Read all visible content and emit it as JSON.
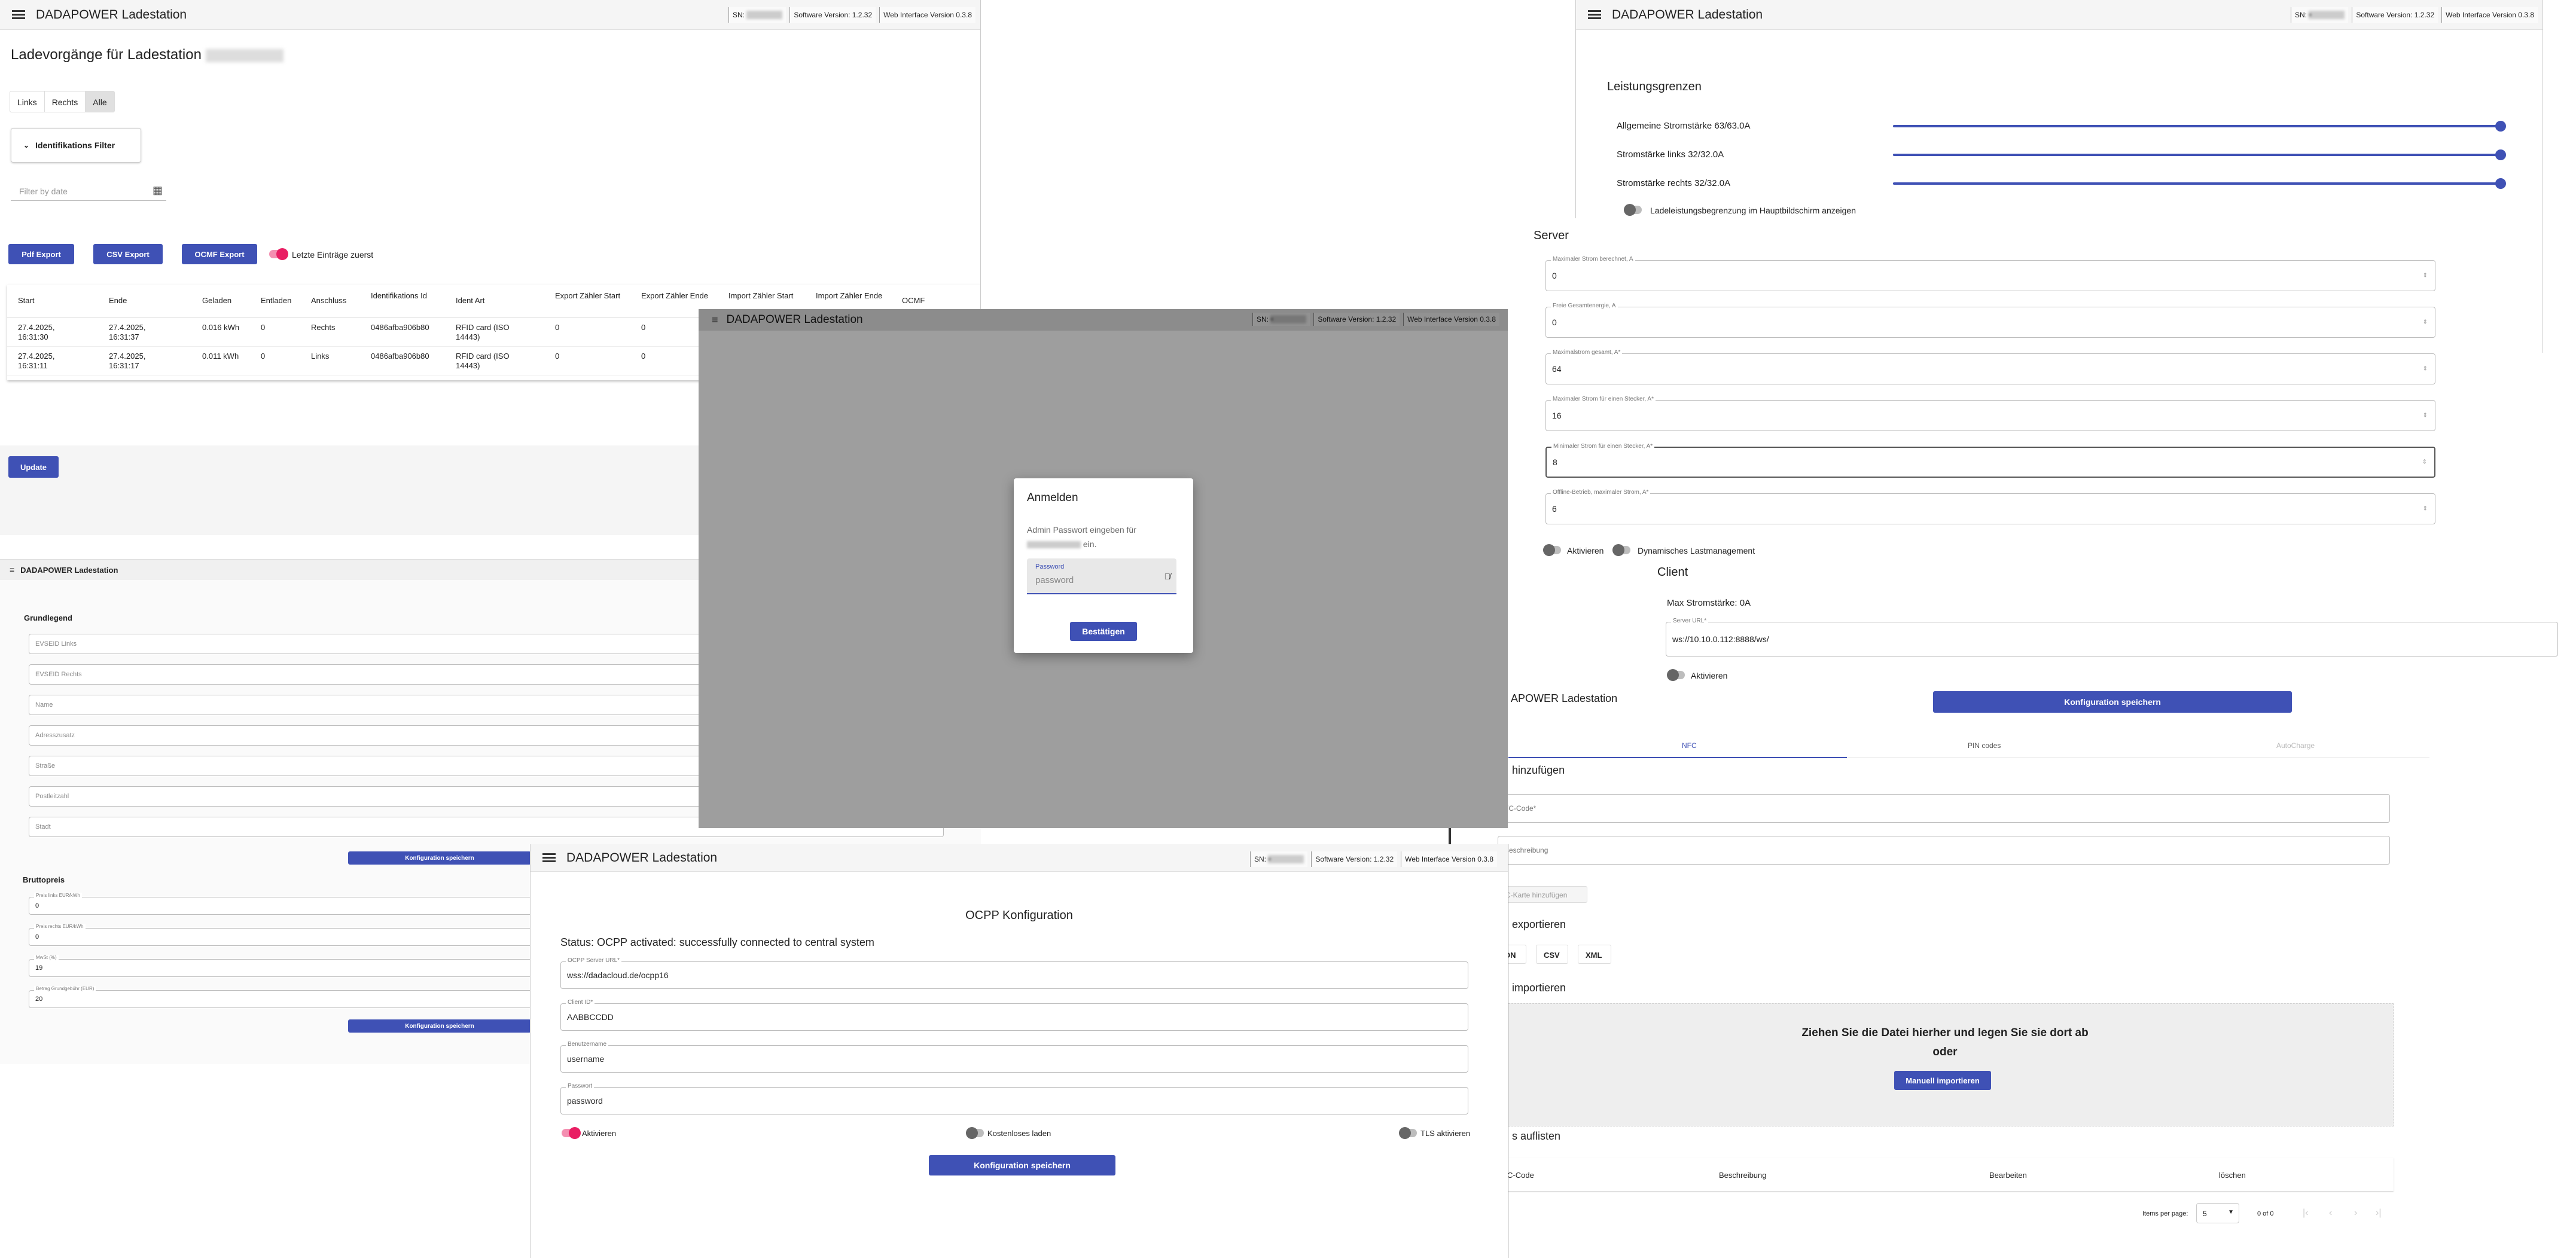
{
  "app": {
    "title": "DADAPOWER Ladestation",
    "sn": "SN:",
    "sw_version": "Software Version: 1.2.32",
    "web_version": "Web Interface Version 0.3.8"
  },
  "history": {
    "heading": "Ladevorgänge für Ladestation",
    "tabs": [
      "Links",
      "Rechts",
      "Alle"
    ],
    "filter_label": "Identifikations Filter",
    "date_placeholder": "Filter by date",
    "buttons": [
      "Pdf Export",
      "CSV Export",
      "OCMF Export"
    ],
    "newest_first_label": "Letzte Einträge zuerst",
    "columns": [
      "Start",
      "Ende",
      "Geladen",
      "Entladen",
      "Anschluss",
      "Identifikations Id",
      "Ident Art",
      "Export Zähler Start",
      "Export Zähler Ende",
      "Import Zähler Start",
      "Import Zähler Ende",
      "OCMF"
    ],
    "rows": [
      [
        "27.4.2025, 16:31:30",
        "27.4.2025, 16:31:37",
        "0.016 kWh",
        "0",
        "Rechts",
        "0486afba906b80",
        "RFID card (ISO 14443)",
        "0",
        "0",
        "",
        "",
        ""
      ],
      [
        "27.4.2025, 16:31:11",
        "27.4.2025, 16:31:17",
        "0.011 kWh",
        "0",
        "Links",
        "0486afba906b80",
        "RFID card (ISO 14443)",
        "0",
        "0",
        "",
        "",
        ""
      ]
    ],
    "update_label": "Update"
  },
  "basic": {
    "title": "DADAPOWER Ladestation",
    "section": "Grundlegend",
    "fields": [
      "EVSEID Links",
      "EVSEID Rechts",
      "Name",
      "Adresszusatz",
      "Straße",
      "Postleitzahl",
      "Stadt"
    ],
    "save_label": "Konfiguration speichern",
    "price_section": "Bruttopreis",
    "price_fields": [
      {
        "label": "Preis links EUR/kWh",
        "value": "0"
      },
      {
        "label": "Preis rechts EUR/kWh",
        "value": "0"
      },
      {
        "label": "MwSt (%)",
        "value": "19"
      },
      {
        "label": "Betrag Grundgebühr (EUR)",
        "value": "20"
      }
    ]
  },
  "power": {
    "section": "Leistungsgrenzen",
    "sliders": [
      {
        "label": "Allgemeine Stromstärke 63/63.0A",
        "fraction": 1.0
      },
      {
        "label": "Stromstärke links 32/32.0A",
        "fraction": 1.0
      },
      {
        "label": "Stromstärke rechts 32/32.0A",
        "fraction": 1.0
      }
    ],
    "show_limit_label": "Ladeleistungsbegrenzung im Hauptbildschirm anzeigen"
  },
  "server": {
    "section": "Server",
    "fields": [
      {
        "label": "Maximaler Strom berechnet, A",
        "value": "0"
      },
      {
        "label": "Freie Gesamtenergie, A",
        "value": "0"
      },
      {
        "label": "Maximalstrom gesamt, A*",
        "value": "64"
      },
      {
        "label": "Maximaler Strom für einen Stecker, A*",
        "value": "16"
      },
      {
        "label": "Minimaler Strom für einen Stecker, A*",
        "value": "8"
      },
      {
        "label": "Offline-Betrieb, maximaler Strom, A*",
        "value": "6"
      }
    ],
    "activate_label": "Aktivieren",
    "dynamic_label": "Dynamisches Lastmanagement"
  },
  "client": {
    "section": "Client",
    "max_current": "Max Stromstärke: 0A",
    "url_label": "Server URL*",
    "url_value": "ws://10.10.0.112:8888/ws/",
    "activate_label": "Aktivieren",
    "save_label": "Konfiguration speichern"
  },
  "nfc": {
    "title": "APOWER Ladestation",
    "tabs": [
      "NFC",
      "PIN codes",
      "AutoCharge"
    ],
    "add_section": "hinzufügen",
    "code_placeholder": "FC-Code*",
    "desc_placeholder": "Beschreibung",
    "add_button": "C-Karte hinzufügen",
    "export_section": "exportieren",
    "export_buttons": [
      "ON",
      "CSV",
      "XML"
    ],
    "import_section": "importieren",
    "drop_text_1": "Ziehen Sie die Datei hierher und legen Sie sie dort ab",
    "drop_text_2": "oder",
    "manual_import": "Manuell importieren",
    "list_section": "s auflisten",
    "columns": [
      "C-Code",
      "Beschreibung",
      "Bearbeiten",
      "löschen"
    ],
    "items_per_page_label": "Items per page:",
    "items_per_page_value": "5",
    "range": "0 of 0"
  },
  "login": {
    "title": "Anmelden",
    "text_1": "Admin Passwort eingeben für",
    "text_2": "ein.",
    "password_label": "Password",
    "password_placeholder": "password",
    "confirm_label": "Bestätigen"
  },
  "ocpp": {
    "title": "DADAPOWER Ladestation",
    "heading": "OCPP Konfiguration",
    "status": "Status: OCPP activated: successfully connected to central system",
    "fields": [
      {
        "label": "OCPP Server URL*",
        "value": "wss://dadacloud.de/ocpp16"
      },
      {
        "label": "Client ID*",
        "value": "AABBCCDD"
      },
      {
        "label": "Benutzername",
        "value": "username"
      },
      {
        "label": "Passwort",
        "value": "password"
      }
    ],
    "activate_label": "Aktivieren",
    "free_label": "Kostenloses laden",
    "tls_label": "TLS aktivieren",
    "save_label": "Konfiguration speichern"
  }
}
